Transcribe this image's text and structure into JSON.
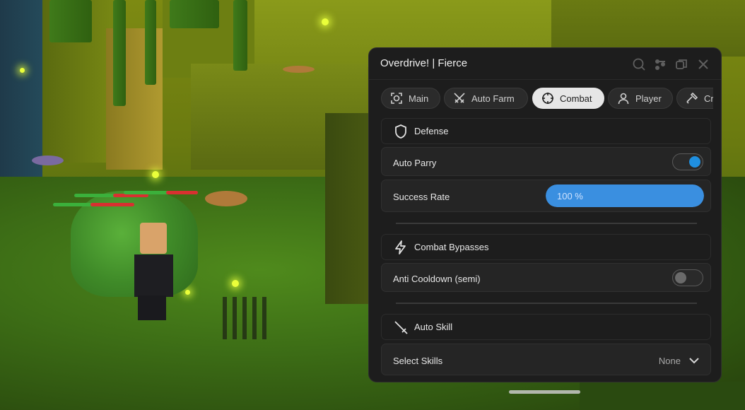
{
  "window": {
    "title": "Overdrive! | Fierce",
    "controls": [
      "search-icon",
      "settings-icon",
      "restore-icon",
      "close-icon"
    ]
  },
  "tabs": [
    {
      "label": "Main",
      "icon": "target-icon",
      "active": false
    },
    {
      "label": "Auto Farm",
      "icon": "swords-icon",
      "active": false
    },
    {
      "label": "Combat",
      "icon": "crosshair-icon",
      "active": true
    },
    {
      "label": "Player",
      "icon": "user-icon",
      "active": false
    },
    {
      "label": "Cr",
      "icon": "hammer-icon",
      "active": false
    }
  ],
  "sections": {
    "defense": {
      "title": "Defense",
      "icon": "shield-icon",
      "auto_parry": {
        "label": "Auto Parry",
        "enabled": true
      },
      "success_rate": {
        "label": "Success Rate",
        "value": 100,
        "display": "100 %"
      }
    },
    "combat_bypasses": {
      "title": "Combat Bypasses",
      "icon": "lightning-icon",
      "anti_cooldown": {
        "label": "Anti Cooldown (semi)",
        "enabled": false
      }
    },
    "auto_skill": {
      "title": "Auto Skill",
      "icon": "sword-icon",
      "select_skills": {
        "label": "Select Skills",
        "value": "None"
      }
    }
  },
  "colors": {
    "panel_bg": "#1d1d1d",
    "row_bg": "#252525",
    "accent": "#3a8fe0",
    "toggle_on": "#1f8fe0",
    "text": "#e8e8e8"
  }
}
